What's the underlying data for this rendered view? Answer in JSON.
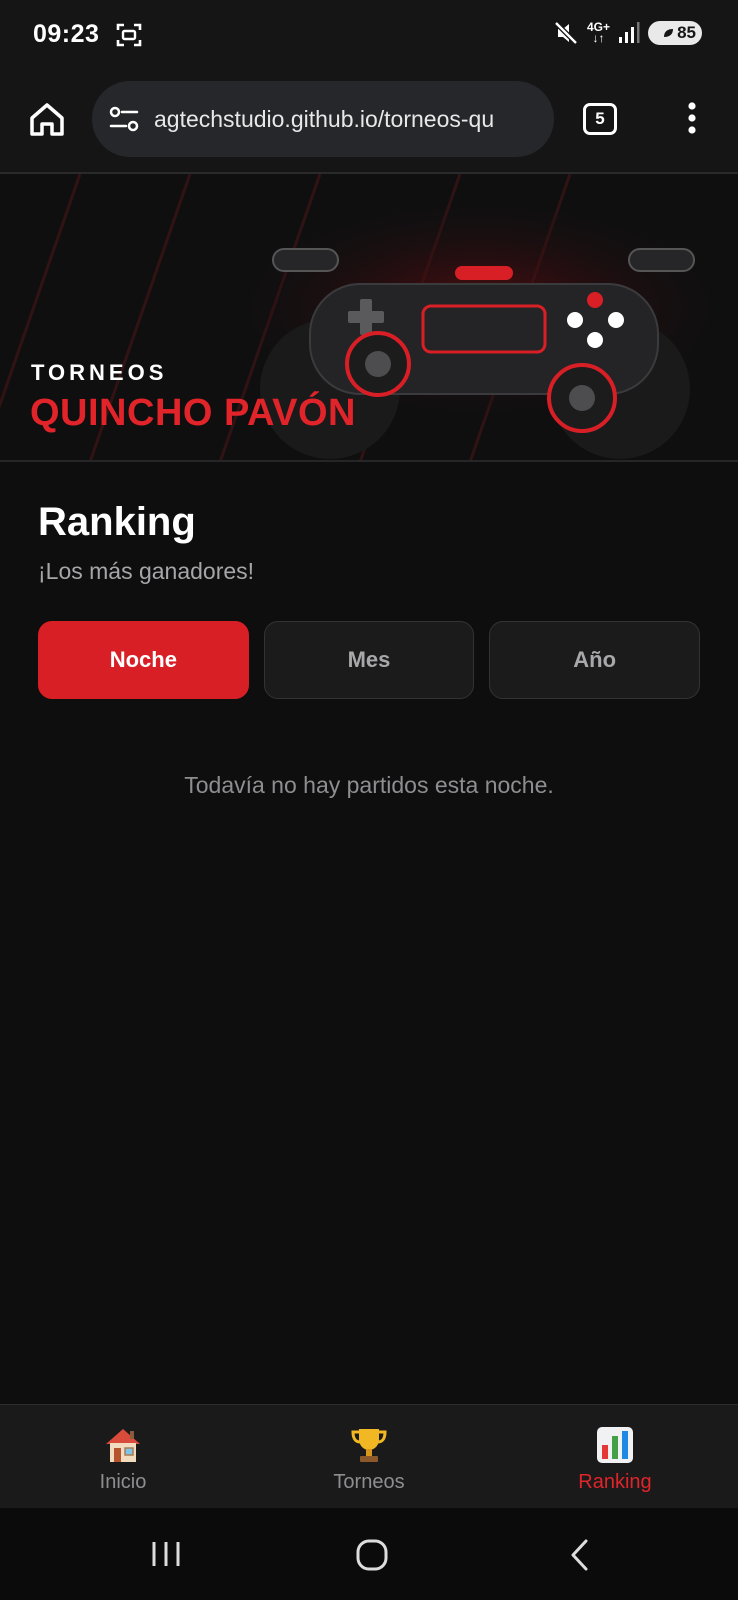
{
  "status_bar": {
    "time": "09:23",
    "network": "4G+",
    "battery": "85",
    "icons": [
      "screenshot-icon",
      "mute-icon",
      "signal-icon",
      "battery-icon"
    ]
  },
  "browser": {
    "url": "agtechstudio.github.io/torneos-qu",
    "tab_count": "5"
  },
  "hero": {
    "kicker": "TORNEOS",
    "title": "QUINCHO PAVÓN",
    "accent_color": "#e0242a"
  },
  "ranking": {
    "title": "Ranking",
    "subtitle": "¡Los más ganadores!",
    "tabs": [
      {
        "label": "Noche",
        "active": true
      },
      {
        "label": "Mes",
        "active": false
      },
      {
        "label": "Año",
        "active": false
      }
    ],
    "empty_message": "Todavía no hay partidos esta noche."
  },
  "bottom_nav": {
    "items": [
      {
        "label": "Inicio",
        "icon": "house-icon",
        "active": false
      },
      {
        "label": "Torneos",
        "icon": "trophy-icon",
        "active": false
      },
      {
        "label": "Ranking",
        "icon": "bar-chart-icon",
        "active": true
      }
    ]
  },
  "colors": {
    "background": "#0e0e0f",
    "accent": "#d91f26",
    "muted_text": "#8e8e90"
  }
}
